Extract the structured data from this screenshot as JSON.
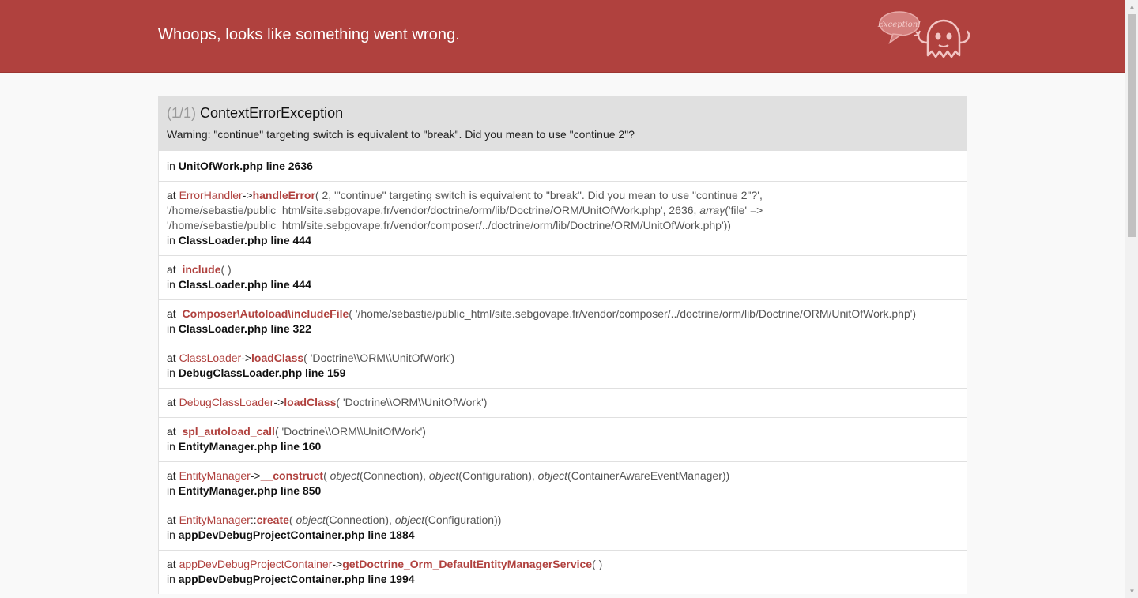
{
  "header": {
    "title": "Whoops, looks like something went wrong.",
    "bubble_text": "Exception!"
  },
  "exception": {
    "count": "(1/1)",
    "name": "ContextErrorException",
    "message": "Warning: \"continue\" targeting switch is equivalent to \"break\". Did you mean to use \"continue 2\"?"
  },
  "location": {
    "prefix": "in",
    "file": "UnitOfWork.php line 2636"
  },
  "trace": [
    {
      "at": "at",
      "class": "ErrorHandler",
      "sep": "->",
      "func": "handleError",
      "args_line1": "( 2, '\"continue\" targeting switch is equivalent to \"break\". Did you mean to use \"continue 2\"?',",
      "args_line2a": "'/home/sebastie/public_html/site.sebgovape.fr/vendor/doctrine/orm/lib/Doctrine/ORM/UnitOfWork.php', 2636, ",
      "args_line2_type": "array",
      "args_line2b": "('file' =>",
      "args_line3": "'/home/sebastie/public_html/site.sebgovape.fr/vendor/composer/../doctrine/orm/lib/Doctrine/ORM/UnitOfWork.php'))",
      "in": "in",
      "file": "ClassLoader.php line 444"
    },
    {
      "at": "at",
      "func": "include",
      "args": "( )",
      "in": "in",
      "file": "ClassLoader.php line 444"
    },
    {
      "at": "at",
      "func": "Composer\\Autoload\\includeFile",
      "args": "( '/home/sebastie/public_html/site.sebgovape.fr/vendor/composer/../doctrine/orm/lib/Doctrine/ORM/UnitOfWork.php')",
      "in": "in",
      "file": "ClassLoader.php line 322"
    },
    {
      "at": "at",
      "class": "ClassLoader",
      "sep": "->",
      "func": "loadClass",
      "args": "( 'Doctrine\\\\ORM\\\\UnitOfWork')",
      "in": "in",
      "file": "DebugClassLoader.php line 159"
    },
    {
      "at": "at",
      "class": "DebugClassLoader",
      "sep": "->",
      "func": "loadClass",
      "args": "( 'Doctrine\\\\ORM\\\\UnitOfWork')"
    },
    {
      "at": "at",
      "func": "spl_autoload_call",
      "args": "( 'Doctrine\\\\ORM\\\\UnitOfWork')",
      "in": "in",
      "file": "EntityManager.php line 160"
    },
    {
      "at": "at",
      "class": "EntityManager",
      "sep": "->",
      "func": "__construct",
      "open": "( ",
      "t1": "object",
      "a1": "(Connection), ",
      "t2": "object",
      "a2": "(Configuration), ",
      "t3": "object",
      "a3": "(ContainerAwareEventManager))",
      "in": "in",
      "file": "EntityManager.php line 850"
    },
    {
      "at": "at",
      "class": "EntityManager",
      "sep": "::",
      "func": "create",
      "open": "( ",
      "t1": "object",
      "a1": "(Connection), ",
      "t2": "object",
      "a2": "(Configuration))",
      "in": "in",
      "file": "appDevDebugProjectContainer.php line 1884"
    },
    {
      "at": "at",
      "class": "appDevDebugProjectContainer",
      "sep": "->",
      "func": "getDoctrine_Orm_DefaultEntityManagerService",
      "args": "( )",
      "in": "in",
      "file": "appDevDebugProjectContainer.php line 1994"
    }
  ],
  "colors": {
    "header_bg": "#b0413e",
    "accent": "#b0413e",
    "block_head_bg": "#e0e0e0",
    "page_bg": "#f9f9f9"
  },
  "icons": [
    "exception-ghost-icon",
    "scroll-up-arrow-icon",
    "scroll-down-arrow-icon"
  ]
}
